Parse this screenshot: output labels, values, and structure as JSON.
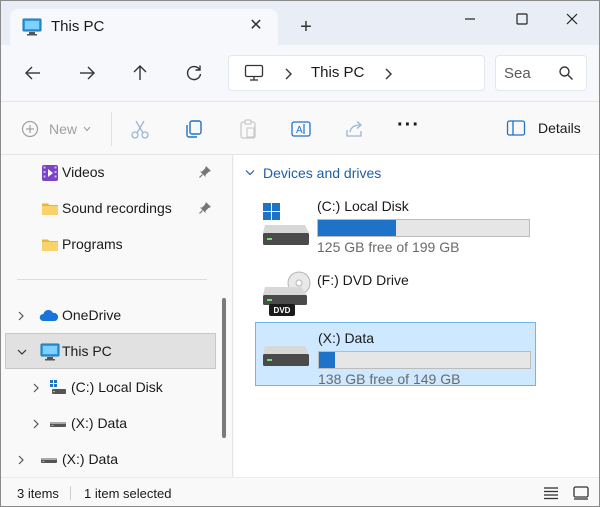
{
  "window": {
    "tab_title": "This PC",
    "tab_close_glyph": "✕",
    "new_tab_glyph": "+"
  },
  "nav": {
    "address_crumb": "This PC",
    "search_placeholder": "Sea"
  },
  "commands": {
    "new_label": "New",
    "details_label": "Details",
    "more_glyph": "···"
  },
  "sidebar": {
    "items": [
      {
        "label": "Videos",
        "icon": "videos-folder-icon",
        "pinned": true
      },
      {
        "label": "Sound recordings",
        "icon": "folder-icon",
        "pinned": true
      },
      {
        "label": "Programs",
        "icon": "folder-icon",
        "pinned": false
      },
      {
        "label": "OneDrive",
        "icon": "onedrive-cloud-icon",
        "expandable": true
      },
      {
        "label": "This PC",
        "icon": "pc-icon",
        "expanded": true,
        "selected": true
      },
      {
        "label": "(C:) Local Disk",
        "icon": "windows-drive-icon",
        "expandable": true
      },
      {
        "label": "(X:) Data",
        "icon": "drive-icon",
        "expandable": true
      },
      {
        "label": "(X:) Data",
        "icon": "drive-icon",
        "expandable": true
      }
    ]
  },
  "content": {
    "group_label": "Devices and drives",
    "drives": [
      {
        "name": "(C:) Local Disk",
        "free_text": "125 GB free of 199 GB",
        "free_gb": 125,
        "total_gb": 199,
        "icon": "windows-drive-icon"
      },
      {
        "name": "(F:) DVD Drive",
        "icon": "dvd-drive-icon",
        "badge": "DVD"
      },
      {
        "name": "(X:) Data",
        "free_text": "138 GB free of 149 GB",
        "free_gb": 138,
        "total_gb": 149,
        "icon": "drive-icon",
        "selected": true
      }
    ]
  },
  "status": {
    "item_count": "3 items",
    "selection": "1 item selected"
  },
  "colors": {
    "accent": "#1e73c9",
    "selection_bg": "#cde8ff",
    "selection_border": "#6cb6f2",
    "link_blue": "#1f5fa8"
  }
}
